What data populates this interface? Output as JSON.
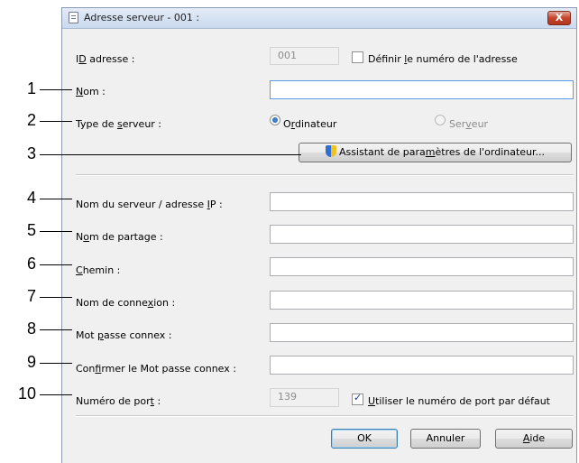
{
  "window": {
    "title": "Adresse serveur - 001 :",
    "close_label": "X"
  },
  "address": {
    "label_pre": "I",
    "label_u": "D",
    "label_post": " adresse :",
    "value": "001",
    "define_pre": "Définir ",
    "define_u": "l",
    "define_post": "e numéro de l'adresse",
    "define_checked": false
  },
  "name": {
    "label_pre": "",
    "label_u": "N",
    "label_post": "om :",
    "value": ""
  },
  "server_type": {
    "label_pre": "Type de ",
    "label_u": "s",
    "label_post": "erveur :",
    "opt1_pre": "O",
    "opt1_u": "r",
    "opt1_post": "dinateur",
    "opt1_selected": true,
    "opt2_pre": "Ser",
    "opt2_u": "v",
    "opt2_post": "eur",
    "opt2_selected": false
  },
  "wizard": {
    "label_pre": "Assistant de para",
    "label_u": "m",
    "label_post": "ètres de l'ordinateur..."
  },
  "server_ip": {
    "label_pre": "Nom du serveur / adresse ",
    "label_u": "I",
    "label_post": "P :",
    "value": ""
  },
  "share": {
    "label_pre": "N",
    "label_u": "o",
    "label_post": "m de partage :",
    "value": ""
  },
  "path": {
    "label_pre": "",
    "label_u": "C",
    "label_post": "hemin :",
    "value": ""
  },
  "login": {
    "label_pre": "Nom de conne",
    "label_u": "x",
    "label_post": "ion :",
    "value": ""
  },
  "password": {
    "label_pre": "Mot ",
    "label_u": "p",
    "label_post": "asse connex :",
    "value": ""
  },
  "confirm": {
    "label_pre": "Con",
    "label_u": "f",
    "label_post": "irmer le Mot passe connex :",
    "value": ""
  },
  "port": {
    "label_pre": "Numéro de por",
    "label_u": "t",
    "label_post": " :",
    "value": "139",
    "default_pre": "",
    "default_u": "U",
    "default_post": "tiliser le numéro de port par défaut",
    "default_checked": true
  },
  "buttons": {
    "ok": "OK",
    "cancel": "Annuler",
    "help_pre": "",
    "help_u": "A",
    "help_post": "ide"
  },
  "callouts": [
    "1",
    "2",
    "3",
    "4",
    "5",
    "6",
    "7",
    "8",
    "9",
    "10"
  ]
}
